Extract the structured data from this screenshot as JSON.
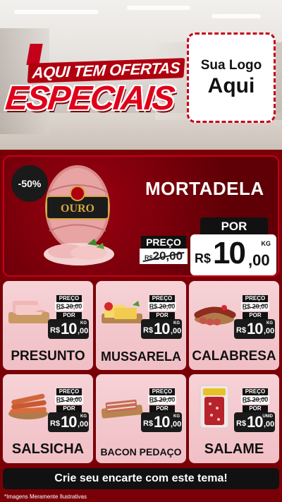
{
  "header": {
    "promo_top": "AQUI TEM OFERTAS",
    "promo_main": "ESPECIAIS",
    "logo_line1": "Sua Logo",
    "logo_line2": "Aqui"
  },
  "featured": {
    "discount": "-50%",
    "title": "MORTADELA",
    "brand_label": "OURO",
    "price_label": "PREÇO",
    "old_currency": "R$",
    "old_price": "20,00",
    "por_label": "POR",
    "currency": "R$",
    "price_int": "10",
    "price_dec": ",00",
    "unit": "KG"
  },
  "products": [
    {
      "name": "PRESUNTO",
      "preco": "PREÇO",
      "old": "R$ 20,00",
      "por": "POR",
      "cur": "R$",
      "int": "10",
      "dec": ",00",
      "unit": "KG"
    },
    {
      "name": "MUSSARELA",
      "preco": "PREÇO",
      "old": "R$ 20,00",
      "por": "POR",
      "cur": "R$",
      "int": "10",
      "dec": ",00",
      "unit": "KG"
    },
    {
      "name": "CALABRESA",
      "preco": "PREÇO",
      "old": "R$ 20,00",
      "por": "POR",
      "cur": "R$",
      "int": "10",
      "dec": ",00",
      "unit": "KG"
    },
    {
      "name": "SALSICHA",
      "preco": "PREÇO",
      "old": "R$ 20,00",
      "por": "POR",
      "cur": "R$",
      "int": "10",
      "dec": ",00",
      "unit": "KG"
    },
    {
      "name": "BACON PEDAÇO",
      "preco": "PREÇO",
      "old": "R$ 20,00",
      "por": "POR",
      "cur": "R$",
      "int": "10",
      "dec": ",00",
      "unit": "KG"
    },
    {
      "name": "SALAME",
      "preco": "PREÇO",
      "old": "R$ 20,00",
      "por": "POR",
      "cur": "R$",
      "int": "10",
      "dec": ",00",
      "unit": "UNID"
    }
  ],
  "cta": "Crie seu encarte com este tema!",
  "disclaimer": "*Imagens Meramente Ilustrativas",
  "colors": {
    "primary_red": "#c4001a",
    "dark_red": "#6f0008",
    "card_pink": "#f6d2d6",
    "black": "#111111"
  }
}
